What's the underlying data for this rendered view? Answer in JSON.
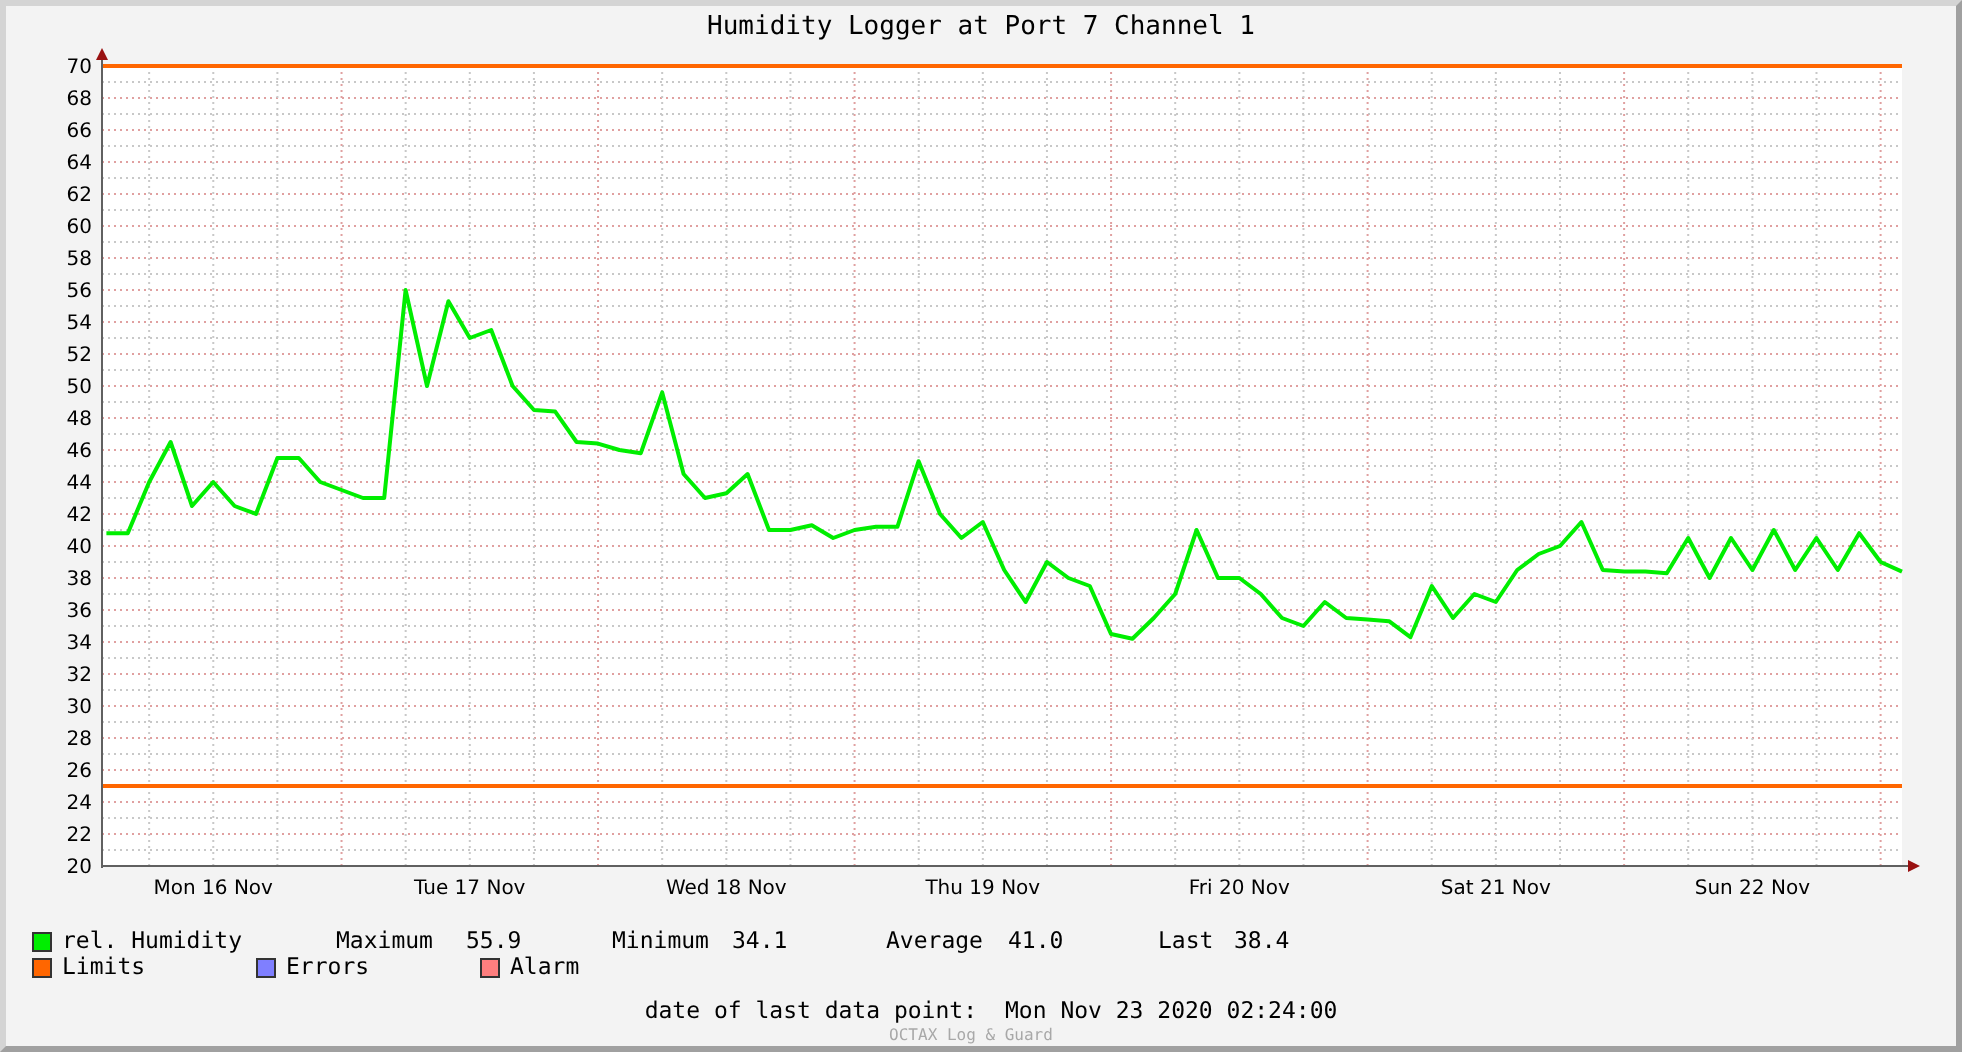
{
  "title": "Humidity Logger at Port 7 Channel 1",
  "chart_data": {
    "type": "line",
    "ylim": [
      20,
      70
    ],
    "yticks": [
      20,
      22,
      24,
      26,
      28,
      30,
      32,
      34,
      36,
      38,
      40,
      42,
      44,
      46,
      48,
      50,
      52,
      54,
      56,
      58,
      60,
      62,
      64,
      66,
      68,
      70
    ],
    "categories": [
      null,
      null,
      null,
      null,
      null,
      "Mon 16 Nov",
      null,
      null,
      null,
      null,
      null,
      null,
      null,
      null,
      null,
      null,
      null,
      "Tue 17 Nov",
      null,
      null,
      null,
      null,
      null,
      null,
      null,
      null,
      null,
      null,
      null,
      "Wed 18 Nov",
      null,
      null,
      null,
      null,
      null,
      null,
      null,
      null,
      null,
      null,
      null,
      "Thu 19 Nov",
      null,
      null,
      null,
      null,
      null,
      null,
      null,
      null,
      null,
      null,
      null,
      "Fri 20 Nov",
      null,
      null,
      null,
      null,
      null,
      null,
      null,
      null,
      null,
      null,
      null,
      "Sat 21 Nov",
      null,
      null,
      null,
      null,
      null,
      null,
      null,
      null,
      null,
      null,
      null,
      "Sun 22 Nov",
      null,
      null,
      null,
      null,
      null,
      null,
      null
    ],
    "series": [
      {
        "name": "rel. Humidity",
        "color": "#00ee00",
        "values": [
          40.8,
          40.8,
          44.0,
          46.5,
          42.5,
          44.0,
          42.5,
          42.0,
          45.5,
          45.5,
          44.0,
          43.5,
          43.0,
          43.0,
          56.0,
          50.0,
          55.3,
          53.0,
          53.5,
          50.0,
          48.5,
          48.4,
          46.5,
          46.4,
          46.0,
          45.8,
          49.6,
          44.5,
          43.0,
          43.3,
          44.5,
          41.0,
          41.0,
          41.3,
          40.5,
          41.0,
          41.2,
          41.2,
          45.3,
          42.0,
          40.5,
          41.5,
          38.5,
          36.5,
          39.0,
          38.0,
          37.5,
          34.5,
          34.2,
          35.5,
          37.0,
          41.0,
          38.0,
          38.0,
          37.0,
          35.5,
          35.0,
          36.5,
          35.5,
          35.4,
          35.3,
          34.3,
          37.5,
          35.5,
          37.0,
          36.5,
          38.5,
          39.5,
          40.0,
          41.5,
          38.5,
          38.4,
          38.4,
          38.3,
          40.5,
          38.0,
          40.5,
          38.5,
          41.0,
          38.5,
          40.5,
          38.5,
          40.8,
          39.0,
          38.4
        ]
      }
    ],
    "grid": true,
    "ref_lines": [
      {
        "axis": "y",
        "value": 70
      },
      {
        "axis": "y",
        "value": 25
      }
    ]
  },
  "legend": [
    {
      "stats": [
        {
          "label": "Maximum",
          "value": "55.9"
        },
        {
          "label": "Minimum",
          "value": "34.1"
        },
        {
          "label": "Average",
          "value": "41.0"
        },
        {
          "label": "Last",
          "value": "38.4"
        }
      ]
    },
    {
      "label": "Limits",
      "color": "#ff6600"
    },
    {
      "label": "Errors",
      "color": "#7f7fff"
    },
    {
      "label": "Alarm",
      "color": "#ff7f7f"
    }
  ],
  "footer": {
    "label": "date of last data point:",
    "value": "Mon Nov 23 2020 02:24:00"
  },
  "watermark": "OCTAX Log & Guard"
}
